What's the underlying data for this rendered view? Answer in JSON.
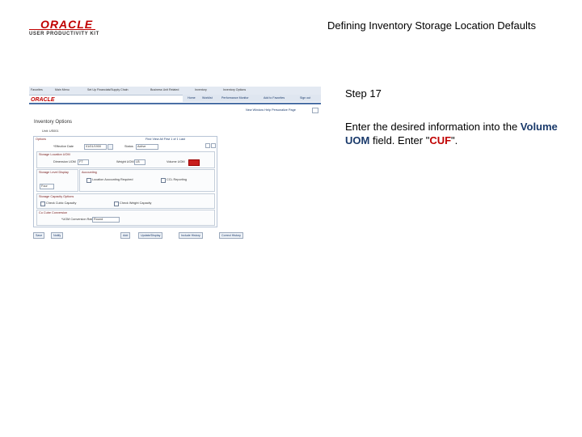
{
  "header": {
    "logo_oracle": "ORACLE",
    "logo_upk": "USER PRODUCTIVITY KIT",
    "title": "Defining Inventory Storage Location Defaults"
  },
  "screenshot": {
    "breadcrumbs": [
      "Favorites",
      "Main Menu",
      "Set Up Financials/Supply Chain",
      "Business Unit Related",
      "Inventory",
      "Inventory Options"
    ],
    "logo": "ORACLE",
    "nav_links": [
      "Home",
      "Worklist",
      "Performance Monitor",
      "Add to Favorites",
      "Sign out"
    ],
    "sub_links": "New Window  Help  Personalize Page",
    "page_title": "Inventory Options",
    "unit_label": "Unit: US001",
    "options_label": "Options",
    "find_label": "Find  View All   First  1 of 1  Last",
    "eff_date_label": "*Effective Date",
    "eff_date_value": "01/01/1900",
    "status_label": "Status",
    "status_value": "Active",
    "storage_uom_title": "Storage Location UOM",
    "dimension_uom_label": "Dimension UOM",
    "dimension_uom_value": "FT",
    "weight_uom_label": "Weight UOM",
    "weight_uom_value": "LB",
    "volume_uom_label": "Volume UOM",
    "storage_display_title": "Storage Level Display",
    "storage_display_value": "Four",
    "accounting_title": "Accounting",
    "loc_acct_label": "Location Accounting Required",
    "ccl_label": "CCL Reporting",
    "capacity_title": "Storage Capacity Options",
    "cube_label": "Check Cubic Capacity",
    "weight_label": "Check Weight Capacity",
    "conv_title": "Cu Cube Conversion",
    "conv_label": "*UOM Conversion Rate",
    "conv_value": "Round",
    "buttons": [
      "Save",
      "Notify",
      "Add",
      "Update/Display",
      "Include History",
      "Correct History"
    ]
  },
  "instructions": {
    "step": "Step 17",
    "text_before": "Enter the desired information into the ",
    "field_name": "Volume UOM",
    "text_middle": " field. Enter \"",
    "value": "CUF",
    "text_after": "\"."
  }
}
